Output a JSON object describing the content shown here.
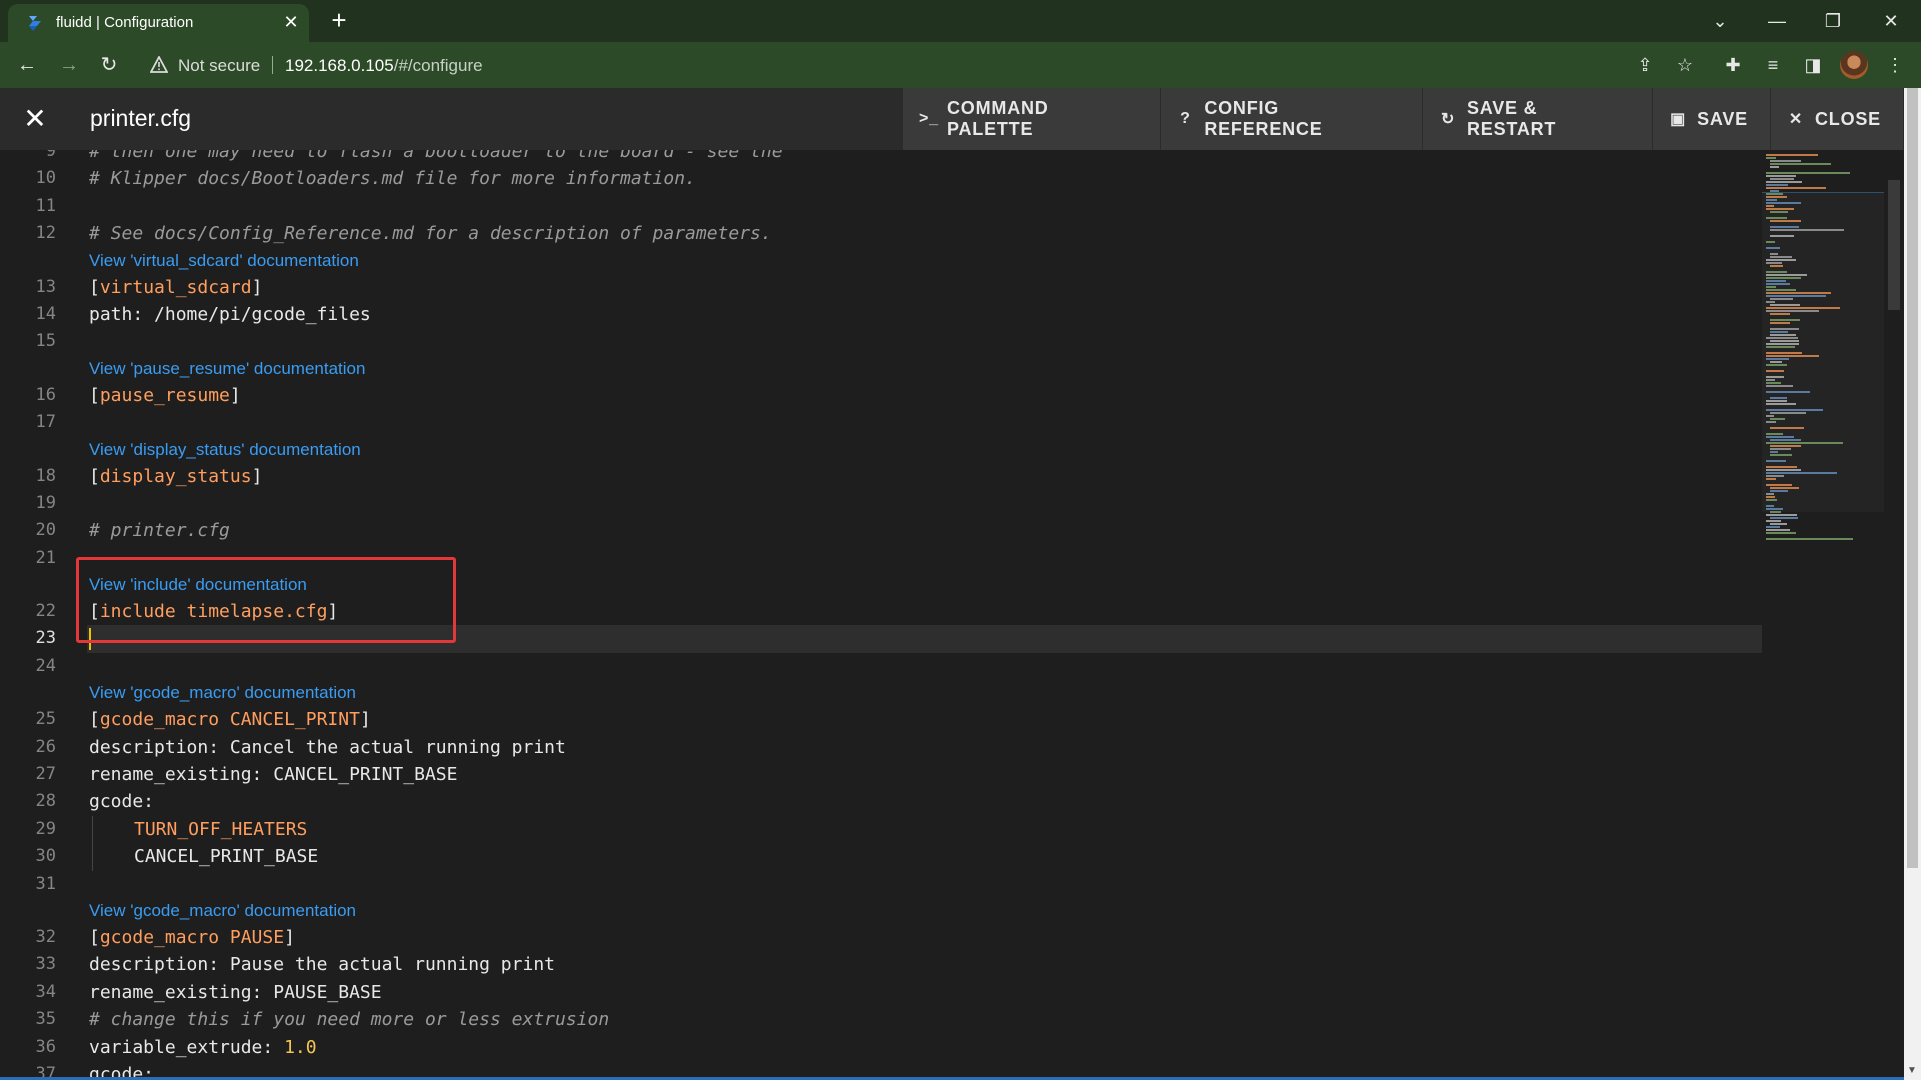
{
  "browser": {
    "tab_title": "fluidd | Configuration",
    "not_secure": "Not secure",
    "url_host": "192.168.0.105",
    "url_path": "/#/configure"
  },
  "app": {
    "file_title": "printer.cfg",
    "toolbar": {
      "command_palette": "COMMAND PALETTE",
      "config_reference": "CONFIG REFERENCE",
      "save_restart": "SAVE & RESTART",
      "save": "SAVE",
      "close": "CLOSE"
    }
  },
  "editor": {
    "lines": [
      {
        "n": "9",
        "text": "# then one may need to flash a bootloader to the board - see the",
        "type": "comment"
      },
      {
        "n": "10",
        "text": "# Klipper docs/Bootloaders.md file for more information.",
        "type": "comment"
      },
      {
        "n": "11",
        "text": "",
        "type": "plain"
      },
      {
        "n": "12",
        "text": "# See docs/Config_Reference.md for a description of parameters.",
        "type": "comment"
      },
      {
        "lens": "View 'virtual_sdcard' documentation"
      },
      {
        "n": "13",
        "text": "virtual_sdcard",
        "type": "section"
      },
      {
        "n": "14",
        "text": "path: /home/pi/gcode_files",
        "type": "plain"
      },
      {
        "n": "15",
        "text": "",
        "type": "plain"
      },
      {
        "lens": "View 'pause_resume' documentation"
      },
      {
        "n": "16",
        "text": "pause_resume",
        "type": "section"
      },
      {
        "n": "17",
        "text": "",
        "type": "plain"
      },
      {
        "lens": "View 'display_status' documentation"
      },
      {
        "n": "18",
        "text": "display_status",
        "type": "section"
      },
      {
        "n": "19",
        "text": "",
        "type": "plain"
      },
      {
        "n": "20",
        "text": "# printer.cfg",
        "type": "comment"
      },
      {
        "n": "21",
        "text": "",
        "type": "plain"
      },
      {
        "lens": "View 'include' documentation"
      },
      {
        "n": "22",
        "text": "include timelapse.cfg",
        "type": "section"
      },
      {
        "n": "23",
        "text": "",
        "type": "current"
      },
      {
        "n": "24",
        "text": "",
        "type": "plain"
      },
      {
        "lens": "View 'gcode_macro' documentation"
      },
      {
        "n": "25",
        "text": "gcode_macro CANCEL_PRINT",
        "type": "section"
      },
      {
        "n": "26",
        "text": "description: Cancel the actual running print",
        "type": "plain"
      },
      {
        "n": "27",
        "text": "rename_existing: CANCEL_PRINT_BASE",
        "type": "plain"
      },
      {
        "n": "28",
        "text": "gcode:",
        "type": "plain"
      },
      {
        "n": "29",
        "text": "TURN_OFF_HEATERS",
        "type": "indent-kw"
      },
      {
        "n": "30",
        "text": "CANCEL_PRINT_BASE",
        "type": "indent"
      },
      {
        "n": "31",
        "text": "",
        "type": "plain"
      },
      {
        "lens": "View 'gcode_macro' documentation"
      },
      {
        "n": "32",
        "text": "gcode_macro PAUSE",
        "type": "section"
      },
      {
        "n": "33",
        "text": "description: Pause the actual running print",
        "type": "plain"
      },
      {
        "n": "34",
        "text": "rename_existing: PAUSE_BASE",
        "type": "plain"
      },
      {
        "n": "35",
        "text": "# change this if you need more or less extrusion",
        "type": "comment"
      },
      {
        "n": "36",
        "key": "variable_extrude: ",
        "num": "1.0",
        "type": "kv-num"
      },
      {
        "n": "37",
        "text": "gcode:",
        "type": "plain"
      }
    ]
  },
  "colors": {
    "tab_bg": "#2c4a27",
    "editor_bg": "#1e1e1e",
    "link": "#3a9cf2",
    "section": "#ff9e5e",
    "highlight_box": "#e2383a"
  }
}
